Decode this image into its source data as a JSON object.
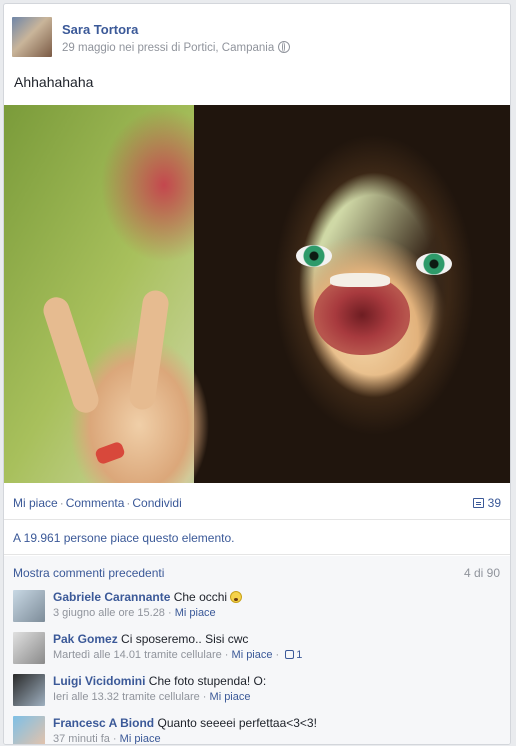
{
  "post": {
    "author": "Sara Tortora",
    "meta": "29 maggio nei pressi di Portici, Campania",
    "privacy_icon": "globe-icon",
    "caption": "Ahhahahaha",
    "photo_alt": "selfie with peace sign"
  },
  "actions": {
    "like": "Mi piace",
    "comment": "Commenta",
    "share": "Condividi",
    "share_count": "39",
    "share_icon": "share-icon"
  },
  "likes_summary": "A 19.961 persone piace questo elemento.",
  "comments": {
    "more_link": "Mostra commenti precedenti",
    "count": "4 di 90",
    "items": [
      {
        "name": "Gabriele Carannante",
        "text": "Che occhi",
        "time": "3 giugno alle ore 15.28",
        "via": "",
        "like": "Mi piace",
        "likes": ""
      },
      {
        "name": "Pak Gomez",
        "text": "Ci sposeremo.. Sisi cwc",
        "time": "Martedì alle 14.01 tramite cellulare",
        "via": "",
        "like": "Mi piace",
        "likes": "1"
      },
      {
        "name": "Luigi Vicidomini",
        "text": "Che foto stupenda! O:",
        "time": "Ieri alle 13.32 tramite cellulare",
        "via": "",
        "like": "Mi piace",
        "likes": ""
      },
      {
        "name": "Francesc A Biond",
        "text": "Quanto seeeei perfettaa<3<3!",
        "time": "37 minuti fa",
        "via": "",
        "like": "Mi piace",
        "likes": ""
      }
    ]
  },
  "colors": {
    "link": "#3b5998",
    "muted": "#90949c",
    "background": "#e9ebee"
  }
}
